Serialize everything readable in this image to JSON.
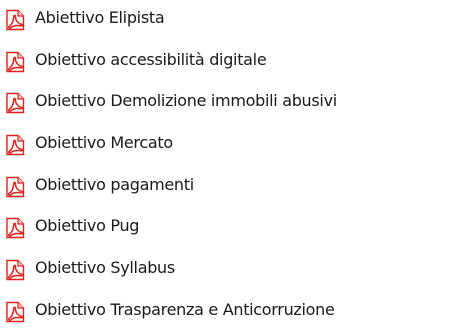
{
  "colors": {
    "pdf_red": "#e2231a",
    "text": "#1a1a1a"
  },
  "files": [
    {
      "icon": "pdf-file-icon",
      "name": "Abiettivo Elipista"
    },
    {
      "icon": "pdf-file-icon",
      "name": "Obiettivo accessibilità digitale"
    },
    {
      "icon": "pdf-file-icon",
      "name": "Obiettivo Demolizione immobili abusivi"
    },
    {
      "icon": "pdf-file-icon",
      "name": "Obiettivo Mercato"
    },
    {
      "icon": "pdf-file-icon",
      "name": "Obiettivo pagamenti"
    },
    {
      "icon": "pdf-file-icon",
      "name": "Obiettivo Pug"
    },
    {
      "icon": "pdf-file-icon",
      "name": "Obiettivo Syllabus"
    },
    {
      "icon": "pdf-file-icon",
      "name": "Obiettivo Trasparenza e Anticorruzione"
    }
  ]
}
